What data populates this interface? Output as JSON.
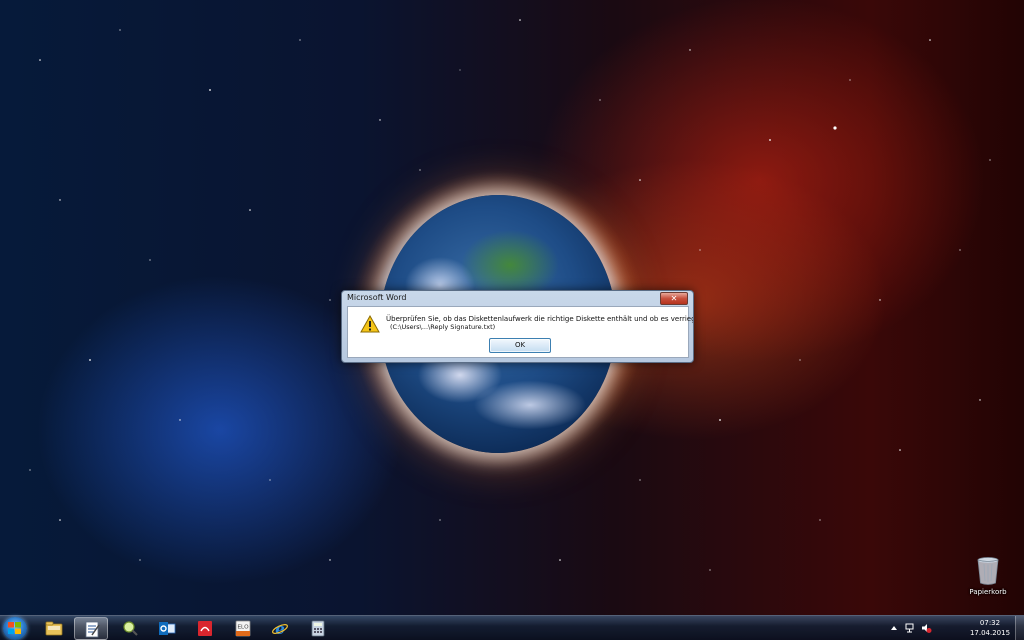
{
  "dialog": {
    "title": "Microsoft Word",
    "close_label": "✕",
    "message_line1": "Überprüfen Sie, ob das Diskettenlaufwerk die richtige Diskette enthält und ob es verriegelt ist.",
    "message_line2": "(C:\\Users\\...\\Reply Signature.txt)",
    "ok_label": "OK",
    "icon": "warning-icon"
  },
  "desktop": {
    "recycle_bin_label": "Papierkorb"
  },
  "taskbar": {
    "items": [
      {
        "name": "explorer",
        "icon": "folder-icon",
        "active": false
      },
      {
        "name": "word-document",
        "icon": "document-icon",
        "active": true
      },
      {
        "name": "search-tool",
        "icon": "magnifier-icon",
        "active": false
      },
      {
        "name": "outlook",
        "icon": "outlook-icon",
        "active": false
      },
      {
        "name": "pdf-app",
        "icon": "pdf-icon",
        "active": false
      },
      {
        "name": "elo",
        "icon": "elo-icon",
        "active": false
      },
      {
        "name": "internet-explorer",
        "icon": "ie-icon",
        "active": false
      },
      {
        "name": "calculator",
        "icon": "calculator-icon",
        "active": false
      }
    ],
    "elo_text": "ELO",
    "clock_time": "07:32",
    "clock_date": "17.04.2015"
  },
  "colors": {
    "dialog_frame": "#b6c8df",
    "ok_border": "#3c7fb1",
    "close_red": "#c7503d"
  }
}
